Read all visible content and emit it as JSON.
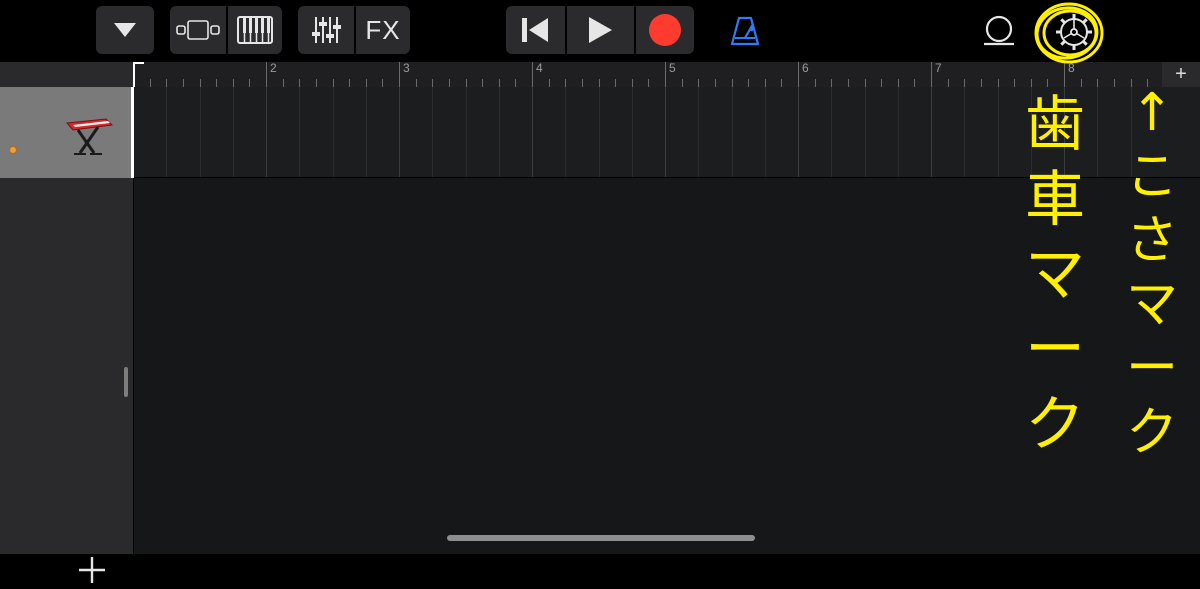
{
  "toolbar": {
    "fx_label": "FX"
  },
  "ruler": {
    "bar_numbers": [
      "2",
      "3",
      "4",
      "5",
      "6",
      "7",
      "8"
    ]
  },
  "track_area": {
    "add_section_label": "+"
  },
  "annotation": {
    "left_text": [
      "歯",
      "車",
      "マ",
      "ー",
      "ク"
    ],
    "right_text": [
      "↑",
      "こ",
      "さ",
      "マ",
      "ー",
      "ク"
    ],
    "color": "#ffef00"
  },
  "colors": {
    "record": "#ff3b30",
    "metronome": "#2f7bf6",
    "track_header_selected": "#7a7a7a",
    "background": "#151718"
  }
}
